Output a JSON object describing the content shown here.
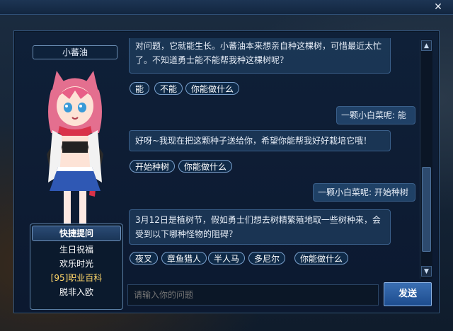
{
  "npc": {
    "name": "小蕃油"
  },
  "quick": {
    "title": "快捷提问",
    "items": [
      "生日祝福",
      "欢乐时光",
      "[95]职业百科",
      "脱非入欧"
    ]
  },
  "chat": {
    "msg1": "对问题，它就能生长。小蕃油本来想亲自种这棵树，可惜最近太忙了。不知道勇士能不能帮我种这棵树呢？",
    "opts1": [
      "能",
      "不能",
      "你能做什么"
    ],
    "reply1": "一颗小白菜呢: 能",
    "msg2": "好呀~我现在把这颗种子送给你，希望你能帮我好好栽培它哦！",
    "opts2": [
      "开始种树",
      "你能做什么"
    ],
    "reply2": "一颗小白菜呢: 开始种树",
    "msg3": "3月12日是植树节，假如勇士们想去树精繁殖地取一些树种来，会受到以下哪种怪物的阻碍？",
    "opts3": [
      "夜叉",
      "章鱼猎人",
      "半人马",
      "多尼尔",
      "你能做什么"
    ]
  },
  "input": {
    "placeholder": "请输入你的问题"
  },
  "send": {
    "label": "发送"
  },
  "close": {
    "label": "✕"
  }
}
